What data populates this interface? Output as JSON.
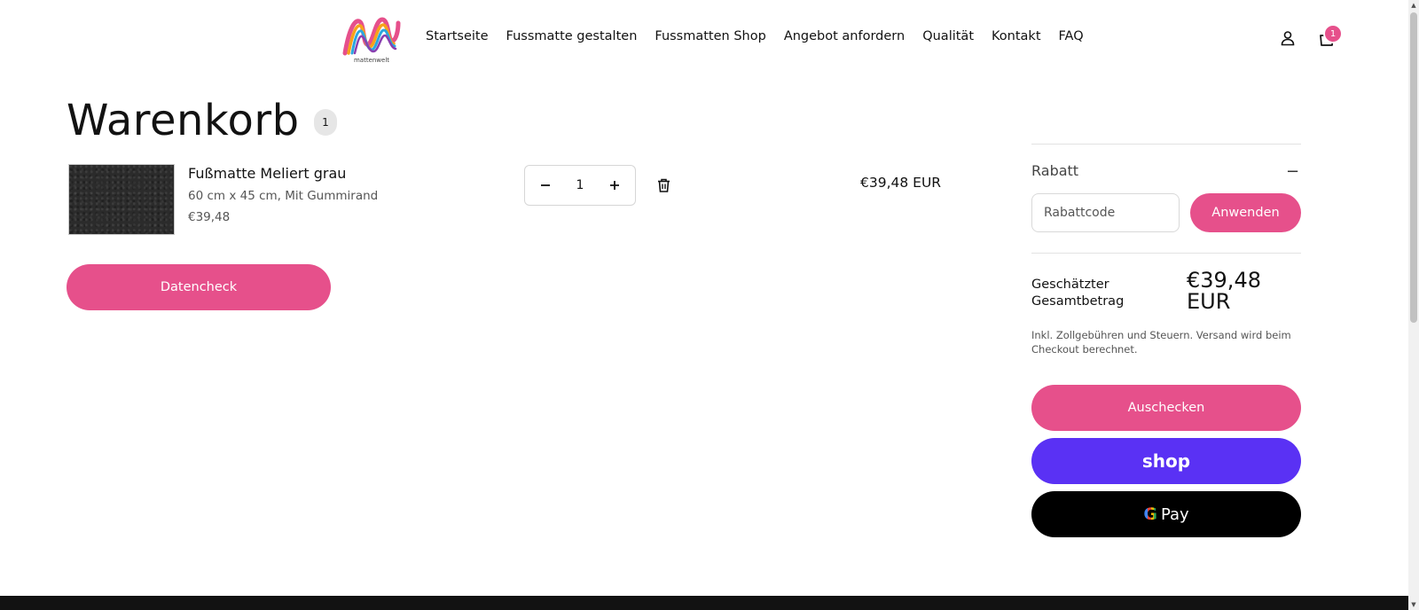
{
  "header": {
    "logo_text": "mattenwelt",
    "nav": [
      "Startseite",
      "Fussmatte gestalten",
      "Fussmatten Shop",
      "Angebot anfordern",
      "Qualität",
      "Kontakt",
      "FAQ"
    ],
    "cart_count": "1",
    "icons": {
      "account": "user-icon",
      "cart": "shopping-bag-icon"
    }
  },
  "cart": {
    "title": "Warenkorb",
    "count": "1",
    "item": {
      "name": "Fußmatte Meliert grau",
      "variant": "60 cm x 45 cm, Mit Gummirand",
      "unit_price": "€39,48",
      "quantity": "1",
      "total": "€39,48 EUR"
    },
    "datencheck_label": "Datencheck"
  },
  "summary": {
    "discount_label": "Rabatt",
    "discount_toggle": "−",
    "discount_placeholder": "Rabattcode",
    "apply_label": "Anwenden",
    "total_label": "Geschätzter Gesamtbetrag",
    "total_value": "€39,48 EUR",
    "tax_note": "Inkl. Zollgebühren und Steuern. Versand wird beim Checkout berechnet.",
    "checkout_label": "Auschecken",
    "shop_pay_label": "shop",
    "gpay_label": "Pay"
  },
  "colors": {
    "accent": "#e6508b",
    "shop_pay": "#5a31f4",
    "gpay": "#000000",
    "footer": "#121212"
  }
}
